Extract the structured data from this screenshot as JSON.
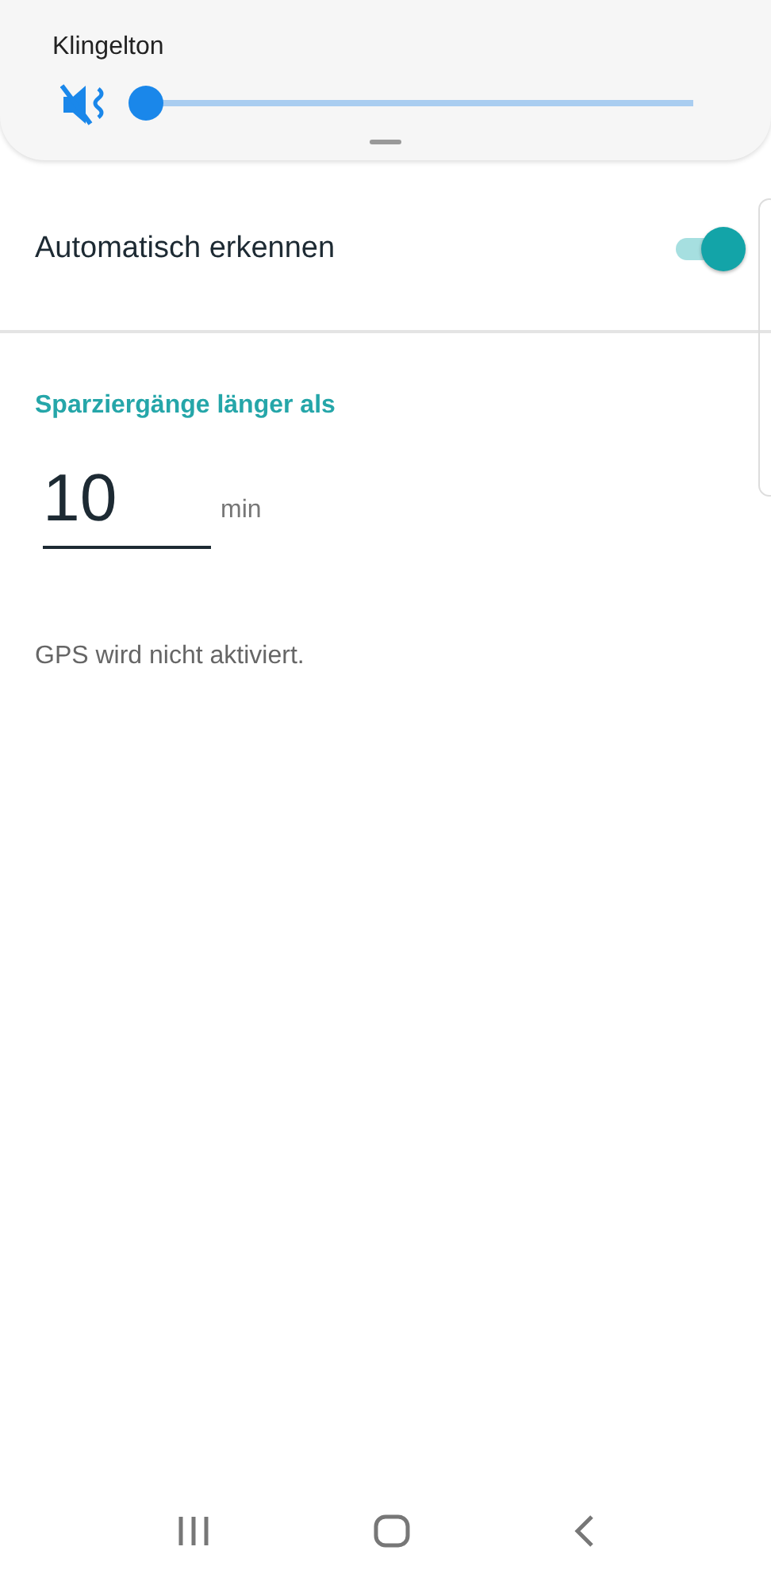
{
  "volume_panel": {
    "label": "Klingelton",
    "muted": true,
    "level": 0
  },
  "auto_detect": {
    "label": "Automatisch erkennen",
    "on": true
  },
  "walk_length": {
    "heading": "Sparziergänge länger als",
    "value": "10",
    "unit": "min"
  },
  "gps_note": "GPS wird nicht aktiviert."
}
